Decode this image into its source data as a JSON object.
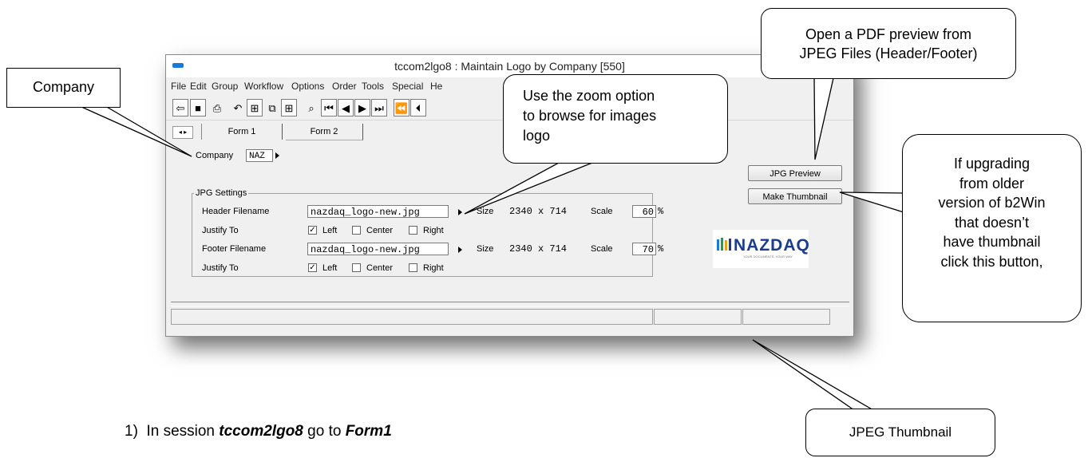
{
  "window": {
    "title": "tccom2lgo8 : Maintain Logo by Company [550]",
    "menu": [
      "File",
      "Edit",
      "Group",
      "Workflow",
      "Options",
      "Order",
      "Tools",
      "Special",
      "He"
    ]
  },
  "tabs": {
    "nav": "◂ ▸",
    "form1": "Form 1",
    "form2": "Form 2"
  },
  "form": {
    "company_label": "Company",
    "company_value": "NAZ",
    "group_title": "JPG Settings",
    "header_label": "Header Filename",
    "header_value": "nazdaq_logo-new.jpg",
    "footer_label": "Footer Filename",
    "footer_value": "nazdaq_logo-new.jpg",
    "justify_label": "Justify To",
    "left": "Left",
    "center": "Center",
    "right": "Right",
    "size_label": "Size",
    "header_size": "2340 x 714",
    "footer_size": "2340 x 714",
    "scale_label": "Scale",
    "header_scale": "60",
    "footer_scale": "70",
    "percent": "%",
    "jpg_preview": "JPG Preview",
    "make_thumbnail": "Make Thumbnail"
  },
  "logo": {
    "text": "NAZDAQ",
    "tagline": "YOUR DOCUMENTS. YOUR WAY"
  },
  "callouts": {
    "company": "Company",
    "zoom": [
      "Use the zoom option",
      "to browse for images",
      "logo"
    ],
    "pdf": [
      "Open a PDF preview from",
      "JPEG Files (Header/Footer)"
    ],
    "upgrade": [
      "If upgrading",
      "from older",
      "version of b2Win",
      "that doesn’t",
      "have thumbnail",
      "click this button,"
    ],
    "thumbnail": "JPEG Thumbnail"
  },
  "instruction": {
    "prefix": "1)  In session ",
    "session": "tccom2lgo8",
    "middle": " go to ",
    "form": "Form1"
  },
  "colors": {
    "accent": "#1a3d8f",
    "titlebar_icon": "#1a7bd6"
  }
}
